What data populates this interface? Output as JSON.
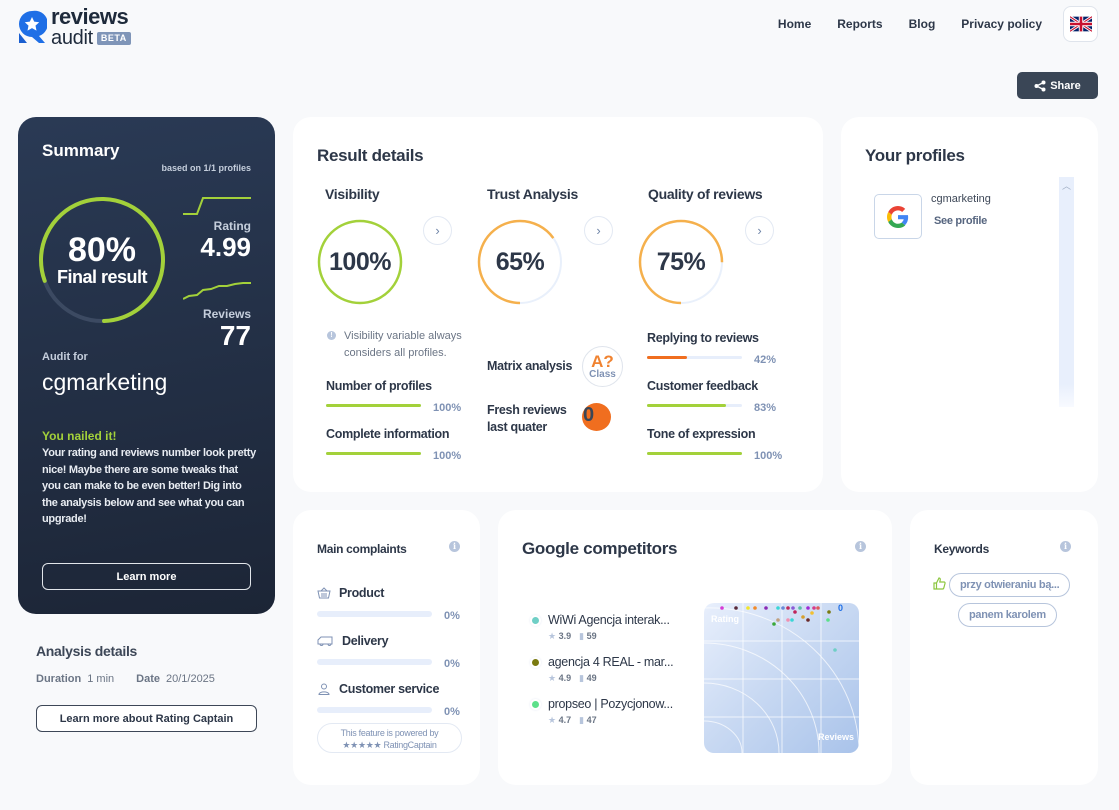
{
  "header": {
    "logo_line1": "reviews",
    "logo_line2": "audit",
    "beta_badge": "BETA",
    "nav": [
      "Home",
      "Reports",
      "Blog",
      "Privacy policy"
    ],
    "language": "en-GB",
    "share_label": "Share"
  },
  "summary": {
    "title": "Summary",
    "based_on": "based on 1/1 profiles",
    "final_percent": "80%",
    "final_percent_value": 80,
    "final_label": "Final result",
    "rating_label": "Rating",
    "rating_value": "4.99",
    "reviews_label": "Reviews",
    "reviews_value": "77",
    "audit_for_label": "Audit for",
    "audit_name": "cgmarketing",
    "verdict_title": "You nailed it!",
    "verdict_text": "Your rating and reviews number look pretty nice! Maybe there are some tweaks that you can make to be even better! Dig into the analysis below and see what you can upgrade!",
    "learn_more": "Learn more",
    "colors": {
      "accent": "#a3d13a"
    }
  },
  "analysis_details": {
    "title": "Analysis details",
    "duration_label": "Duration",
    "duration_value": "1 min",
    "date_label": "Date",
    "date_value": "20/1/2025",
    "button": "Learn more about Rating Captain"
  },
  "result_details": {
    "title": "Result details",
    "columns": [
      {
        "title": "Visibility",
        "percent": "100%",
        "value": 100,
        "color": "#a3d13a"
      },
      {
        "title": "Trust Analysis",
        "percent": "65%",
        "value": 65,
        "color": "#f5b04c"
      },
      {
        "title": "Quality of reviews",
        "percent": "75%",
        "value": 75,
        "color": "#f5b04c"
      }
    ],
    "visibility_note": "Visibility variable always considers all profiles.",
    "visibility_metrics": [
      {
        "name": "Number of profiles",
        "percent": "100%",
        "value": 100,
        "color": "#a3d13a"
      },
      {
        "name": "Complete information",
        "percent": "100%",
        "value": 100,
        "color": "#a3d13a"
      }
    ],
    "matrix_label": "Matrix analysis",
    "matrix_grade": "A?",
    "matrix_class": "Class",
    "fresh_label": "Fresh reviews last quater",
    "fresh_value": "0",
    "quality_metrics": [
      {
        "name": "Replying to reviews",
        "percent": "42%",
        "value": 42,
        "color": "#f06e1f"
      },
      {
        "name": "Customer feedback",
        "percent": "83%",
        "value": 83,
        "color": "#a3d13a"
      },
      {
        "name": "Tone of expression",
        "percent": "100%",
        "value": 100,
        "color": "#a3d13a"
      }
    ]
  },
  "profiles": {
    "title": "Your profiles",
    "items": [
      {
        "platform": "google",
        "name": "cgmarketing",
        "link": "See profile"
      }
    ]
  },
  "complaints": {
    "title": "Main complaints",
    "items": [
      {
        "name": "Product",
        "icon": "basket-icon",
        "percent": "0%"
      },
      {
        "name": "Delivery",
        "icon": "van-icon",
        "percent": "0%"
      },
      {
        "name": "Customer service",
        "icon": "person-icon",
        "percent": "0%"
      }
    ],
    "powered_line1": "This feature is powered by",
    "powered_line2": "★★★★★ RatingCaptain"
  },
  "competitors": {
    "title": "Google competitors",
    "items": [
      {
        "name": "WiWi Agencja interak...",
        "rating": "3.9",
        "reviews": "59",
        "color": "#6fcfc6"
      },
      {
        "name": "agencja 4 REAL - mar...",
        "rating": "4.9",
        "reviews": "49",
        "color": "#7a7a10"
      },
      {
        "name": "propseo | Pozycjonow...",
        "rating": "4.7",
        "reviews": "47",
        "color": "#5de08a"
      }
    ],
    "chart_labels": {
      "y": "Rating",
      "x": "Reviews"
    },
    "you_marker": "0"
  },
  "keywords": {
    "title": "Keywords",
    "items": [
      "przy otwieraniu bą...",
      "panem karolem"
    ]
  }
}
